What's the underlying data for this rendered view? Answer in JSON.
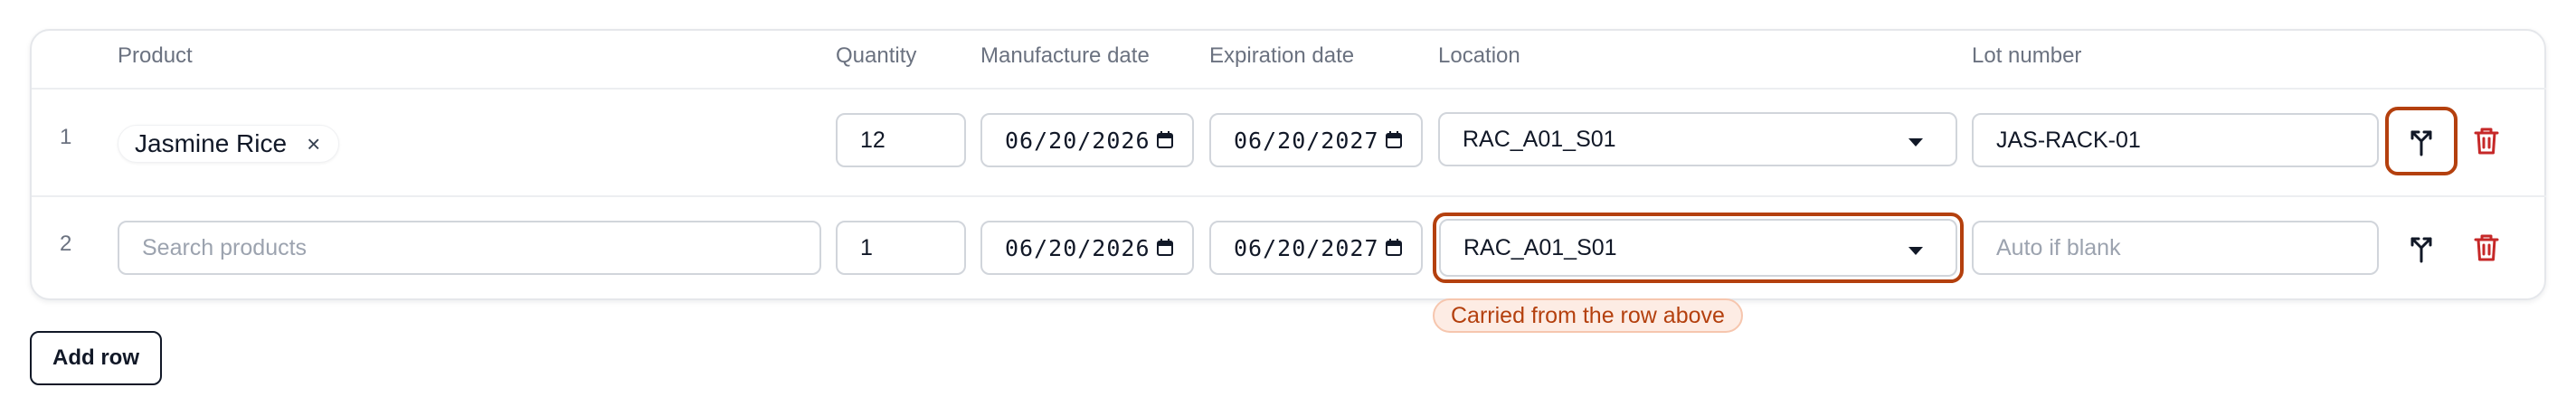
{
  "headers": {
    "product": "Product",
    "quantity": "Quantity",
    "manufacture_date": "Manufacture date",
    "expiration_date": "Expiration date",
    "location": "Location",
    "lot_number": "Lot number"
  },
  "rows": [
    {
      "number": "1",
      "product_chip": "Jasmine Rice",
      "chip_remove": "×",
      "quantity": "12",
      "manufacture_date": "06/20/2026",
      "expiration_date": "06/20/2027",
      "location": "RAC_A01_S01",
      "lot_number": "JAS-RACK-01"
    },
    {
      "number": "2",
      "product_placeholder": "Search products",
      "quantity": "1",
      "manufacture_date": "06/20/2026",
      "expiration_date": "06/20/2027",
      "location": "RAC_A01_S01",
      "lot_placeholder": "Auto if blank",
      "location_note": "Carried from the row above"
    }
  ],
  "add_row_label": "Add row",
  "colors": {
    "accent": "#b4400e",
    "delete": "#c62828",
    "border": "#d1d5db",
    "header_text": "#6b7280"
  },
  "icons": {
    "split": "split-arrows-icon",
    "delete": "trash-icon",
    "calendar": "calendar-icon",
    "dropdown": "caret-down-icon",
    "remove": "close-icon"
  }
}
